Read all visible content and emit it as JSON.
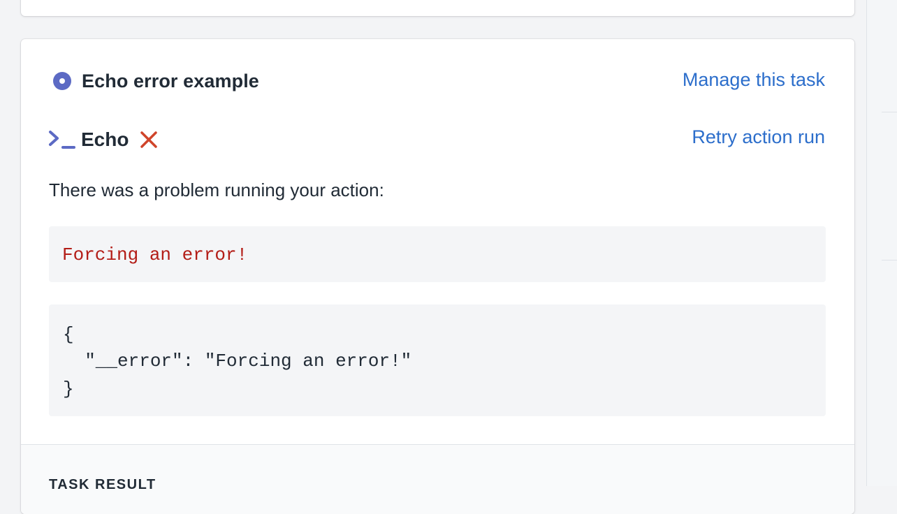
{
  "task": {
    "title": "Echo error example",
    "manage_link": "Manage this task"
  },
  "action": {
    "name": "Echo",
    "retry_link": "Retry action run",
    "status": "failed"
  },
  "error": {
    "intro": "There was a problem running your action:",
    "message": "Forcing an error!",
    "json_open": "{",
    "json_entry": "  \"__error\": \"Forcing an error!\"",
    "json_close": "}"
  },
  "result": {
    "label": "TASK RESULT"
  },
  "icons": {
    "status": "task-status-dot-icon",
    "action": "terminal-prompt-icon",
    "failed": "red-x-icon"
  },
  "colors": {
    "accent": "#5c6ac4",
    "link": "#2c6ecb",
    "error": "#b31d17",
    "failed_icon": "#d0442a"
  }
}
